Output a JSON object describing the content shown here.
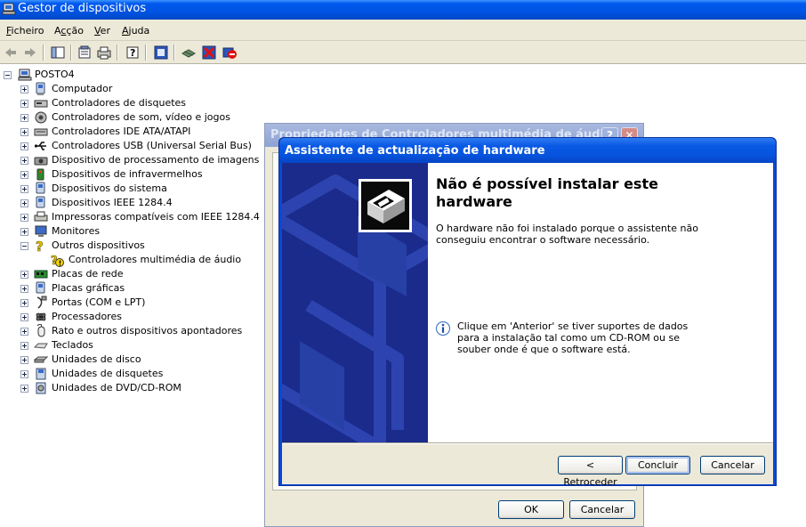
{
  "window": {
    "title": "Gestor de dispositivos"
  },
  "menu": [
    {
      "label": "Ficheiro",
      "accel": "F",
      "rest": "icheiro"
    },
    {
      "label": "Acção",
      "pre": "A",
      "accel": "c",
      "rest": "ção"
    },
    {
      "label": "Ver",
      "accel": "V",
      "rest": "er"
    },
    {
      "label": "Ajuda",
      "accel": "A",
      "rest": "juda"
    }
  ],
  "toolbar": {
    "buttons": [
      "back-icon",
      "forward-icon",
      "console-tree-icon",
      "properties-icon",
      "print-icon",
      "help-icon",
      "scan-hardware-icon",
      "update-driver-icon",
      "uninstall-icon",
      "disable-icon"
    ]
  },
  "tree": {
    "root": "POSTO4",
    "items": [
      {
        "label": "Computador",
        "icon": "computer-icon"
      },
      {
        "label": "Controladores de disquetes",
        "icon": "floppy-controller-icon"
      },
      {
        "label": "Controladores de som, vídeo e jogos",
        "icon": "sound-icon"
      },
      {
        "label": "Controladores IDE ATA/ATAPI",
        "icon": "ide-icon"
      },
      {
        "label": "Controladores USB (Universal Serial Bus)",
        "icon": "usb-icon"
      },
      {
        "label": "Dispositivo de processamento de imagens",
        "icon": "camera-icon"
      },
      {
        "label": "Dispositivos de infravermelhos",
        "icon": "infrared-icon"
      },
      {
        "label": "Dispositivos do sistema",
        "icon": "system-icon"
      },
      {
        "label": "Dispositivos IEEE 1284.4",
        "icon": "ieee-icon"
      },
      {
        "label": "Impressoras compatíveis com IEEE 1284.4",
        "icon": "printer-icon"
      },
      {
        "label": "Monitores",
        "icon": "monitor-icon"
      },
      {
        "label": "Outros dispositivos",
        "icon": "unknown-device-icon",
        "expanded": true,
        "child": "Controladores multimédia de áudio"
      },
      {
        "label": "Placas de rede",
        "icon": "network-card-icon"
      },
      {
        "label": "Placas gráficas",
        "icon": "display-adapter-icon"
      },
      {
        "label": "Portas (COM e LPT)",
        "icon": "port-icon"
      },
      {
        "label": "Processadores",
        "icon": "processor-icon"
      },
      {
        "label": "Rato e outros dispositivos apontadores",
        "icon": "mouse-icon"
      },
      {
        "label": "Teclados",
        "icon": "keyboard-icon"
      },
      {
        "label": "Unidades de disco",
        "icon": "disk-drive-icon"
      },
      {
        "label": "Unidades de disquetes",
        "icon": "floppy-drive-icon"
      },
      {
        "label": "Unidades de DVD/CD-ROM",
        "icon": "dvd-icon"
      }
    ]
  },
  "properties_dialog": {
    "title": "Propriedades de Controladores multimédia de áudio",
    "help": "?",
    "close": "✕",
    "ok_label": "OK",
    "cancel_label": "Cancelar"
  },
  "wizard": {
    "title": "Assistente de actualização de hardware",
    "heading": "Não é possível instalar este hardware",
    "message": "O hardware não foi instalado porque o assistente não conseguiu encontrar o software necessário.",
    "info": "Clique em 'Anterior' se tiver suportes de dados para a instalação tal como um CD-ROM ou se souber onde é que o software está.",
    "back_label": "< Retroceder",
    "finish_label": "Concluir",
    "cancel_label": "Cancelar"
  },
  "colors": {
    "xp_blue_title": "#0054e3",
    "dialog_face": "#ece9d8",
    "wizard_sidebar": "#1a2b8c"
  }
}
